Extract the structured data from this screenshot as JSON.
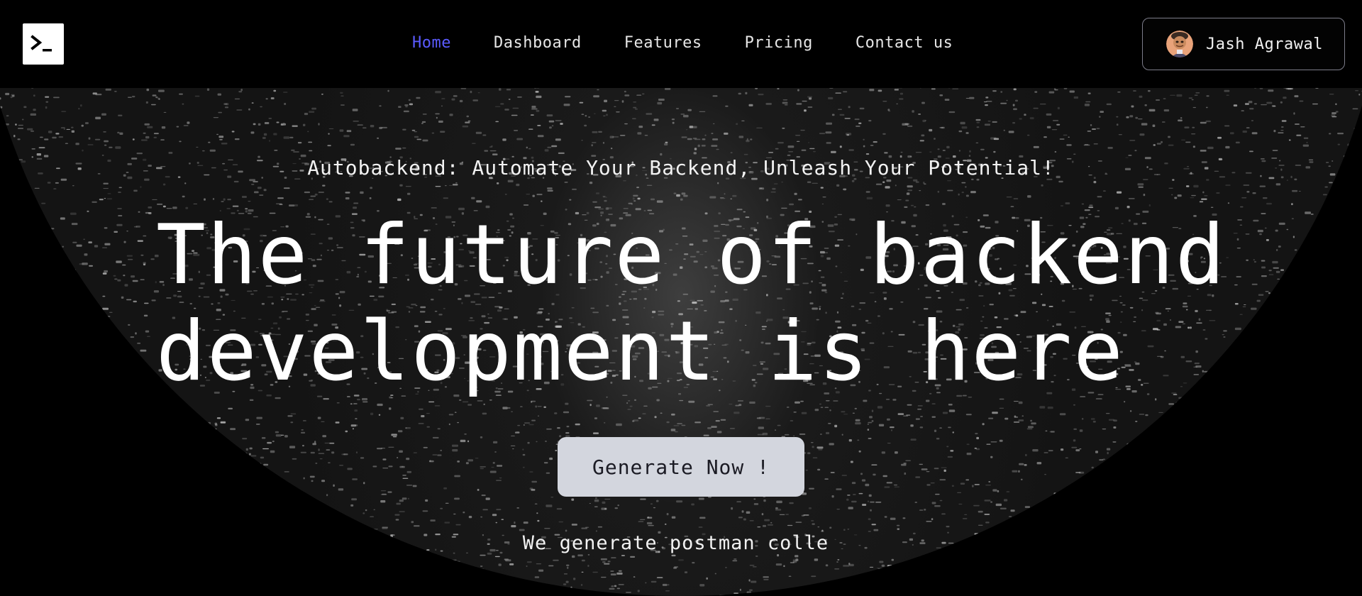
{
  "brand": {
    "logo_icon": "terminal-prompt-icon"
  },
  "nav": {
    "items": [
      {
        "label": "Home",
        "active": true
      },
      {
        "label": "Dashboard",
        "active": false
      },
      {
        "label": "Features",
        "active": false
      },
      {
        "label": "Pricing",
        "active": false
      },
      {
        "label": "Contact us",
        "active": false
      }
    ]
  },
  "user": {
    "name": "Jash Agrawal",
    "avatar_icon": "avatar-icon"
  },
  "hero": {
    "tagline": "Autobackend: Automate Your Backend, Unleash Your Potential!",
    "headline_line1": "The future of backend",
    "headline_line2": "development is here",
    "cta_label": "Generate Now !",
    "subtext": "We generate postman colle"
  },
  "colors": {
    "background": "#000000",
    "active_nav": "#5b5bff",
    "cta_background": "#d3d6de",
    "text": "#f2f2f2"
  }
}
